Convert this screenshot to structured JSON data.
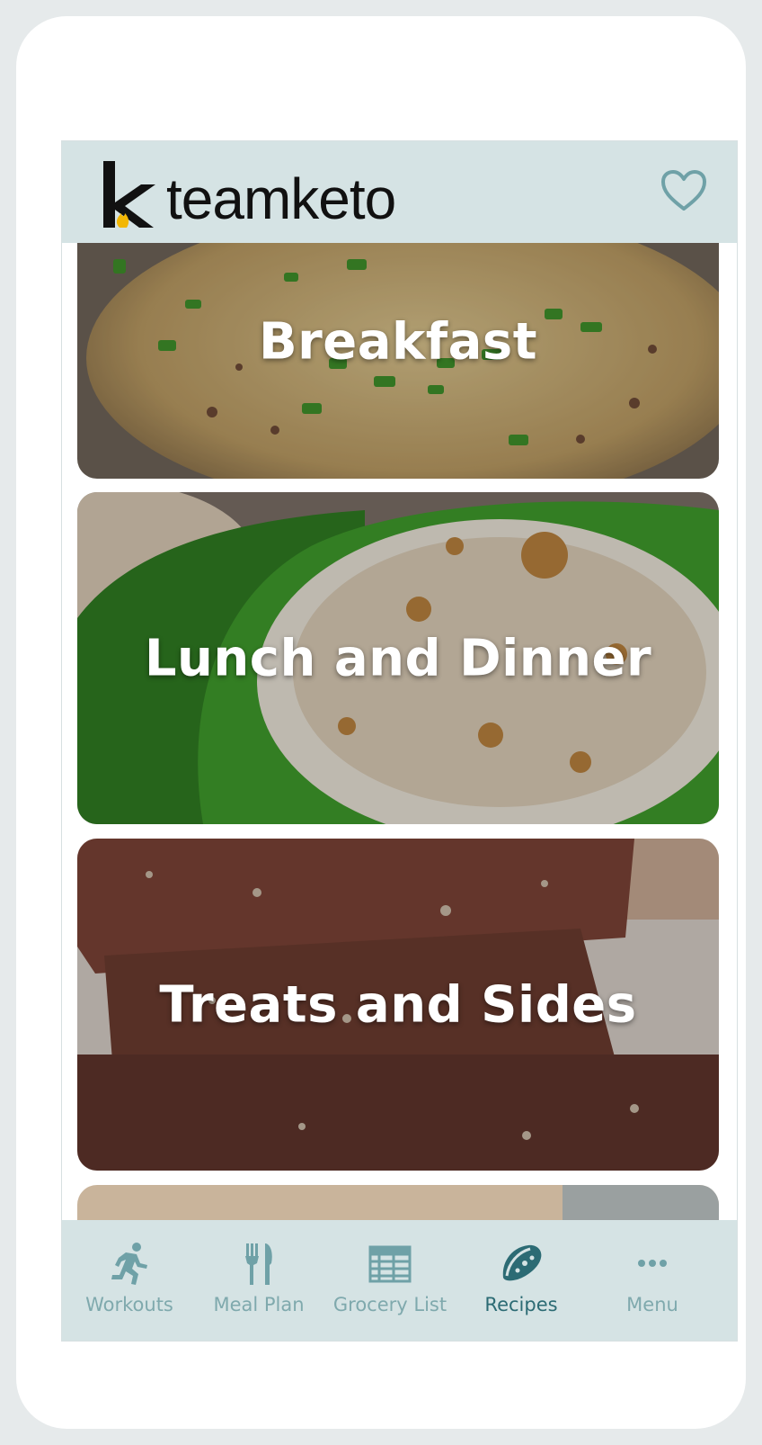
{
  "header": {
    "logo_text": "teamketo",
    "logo_letter": "k",
    "favorite_icon": "heart-outline-icon"
  },
  "categories": [
    {
      "label": "Breakfast",
      "image": "food-photo-breakfast-egg-bake"
    },
    {
      "label": "Lunch and Dinner",
      "image": "food-photo-stuffed-peppers"
    },
    {
      "label": "Treats and Sides",
      "image": "food-photo-chocolate-bars"
    }
  ],
  "tabbar": {
    "tabs": [
      {
        "label": "Workouts",
        "icon": "running-person-icon"
      },
      {
        "label": "Meal Plan",
        "icon": "fork-knife-icon"
      },
      {
        "label": "Grocery List",
        "icon": "grocery-list-icon"
      },
      {
        "label": "Recipes",
        "icon": "taco-icon"
      },
      {
        "label": "Menu",
        "icon": "more-dots-icon"
      }
    ],
    "active_tab": "Recipes"
  },
  "colors": {
    "header_bg": "#d5e3e4",
    "tab_inactive": "#7fa9ad",
    "tab_active": "#2c6b74",
    "logo_flame": "#f2b705"
  }
}
